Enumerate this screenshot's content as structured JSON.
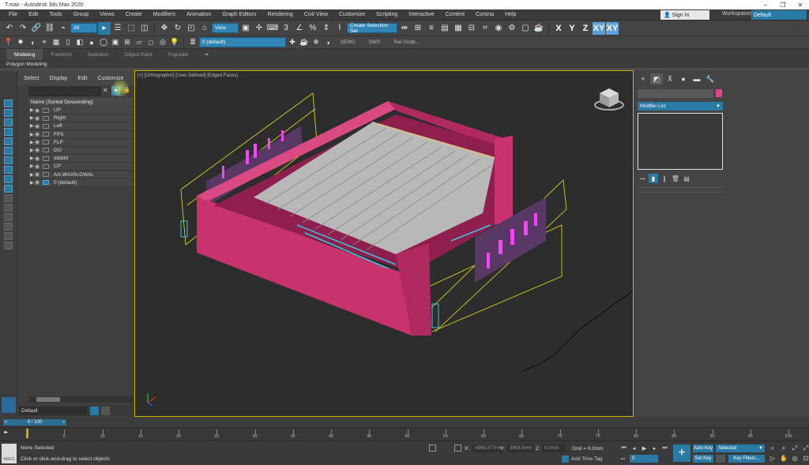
{
  "title_bar": {
    "title": "T.max - Autodesk 3ds Max 2020",
    "minimize": "–",
    "maximize": "❐",
    "close": "✕"
  },
  "menu": [
    "File",
    "Edit",
    "Tools",
    "Group",
    "Views",
    "Create",
    "Modifiers",
    "Animation",
    "Graph Editors",
    "Rendering",
    "Civil View",
    "Customize",
    "Scripting",
    "Interactive",
    "Content",
    "Corona",
    "Help"
  ],
  "account": {
    "sign_in": "Sign In",
    "workspaces_label": "Workspaces:",
    "workspace_value": "Default"
  },
  "toolbar": {
    "selection_filter": "All",
    "reference_coord": "View",
    "named_selection": "Create Selection Set",
    "axis_buttons": [
      "X",
      "Y",
      "Z",
      "XY",
      "XY"
    ],
    "layer_dropdown": "0 (default)",
    "text_buttons": [
      "DEWG",
      "DWG",
      "Rail Script..."
    ]
  },
  "ribbon": {
    "tabs": [
      "Modeling",
      "Freeform",
      "Selection",
      "Object Paint",
      "Populate"
    ],
    "sub_label": "Polygon Modeling"
  },
  "scene_explorer": {
    "menu": [
      "Select",
      "Display",
      "Edit",
      "Customize"
    ],
    "column_header": "Name (Sorted Descending)",
    "layers": [
      "UP",
      "Right",
      "Left",
      "FPS",
      "FLP",
      "DO",
      "ddddd",
      "CP",
      "AA-WAXN-DWAL",
      "0 (default)"
    ],
    "bottom_dropdown": "Default"
  },
  "viewport": {
    "label": "[+] [Orthographic] [User Defined] [Edged Faces]",
    "colors": {
      "building": "#c8336e",
      "building_dark": "#8f1f4e",
      "roof": "#b8b8b8",
      "frame_outline": "#e6e600",
      "highlight_blue": "#3ec5e0",
      "magenta": "#ff40ff"
    }
  },
  "command_panel": {
    "tabs": [
      "+",
      "modify",
      "hierarchy",
      "motion",
      "display",
      "utilities"
    ],
    "modifier_list": "Modifier List",
    "object_color": "#e0458e"
  },
  "timeline": {
    "frame_slider": "0 / 100",
    "ticks": [
      0,
      5,
      10,
      15,
      20,
      25,
      30,
      35,
      40,
      45,
      50,
      55,
      60,
      65,
      70,
      75,
      80,
      85,
      90,
      95,
      100
    ]
  },
  "status": {
    "maxscript_label": "MAXS",
    "selection": "None Selected",
    "prompt": "Click or click-and-drag to select objects",
    "x_label": "X:",
    "x_value": "-4963.877mm",
    "y_label": "Y:",
    "y_value": "3963.5mm",
    "z_label": "Z:",
    "z_value": "0.0mm",
    "grid": "Grid = 0.0mm",
    "add_time_tag": "Add Time Tag",
    "frame_value": "0",
    "auto_key": "Auto Key",
    "set_key": "Set Key",
    "selected": "Selected",
    "key_filters": "Key Filters..."
  }
}
